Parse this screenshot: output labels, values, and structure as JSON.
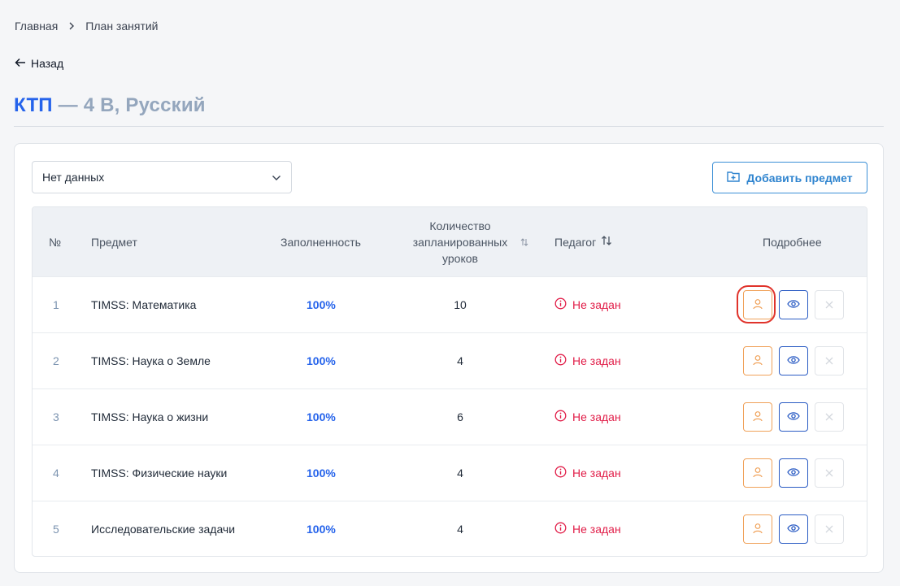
{
  "breadcrumb": {
    "home": "Главная",
    "current": "План занятий"
  },
  "back_label": "Назад",
  "title": {
    "accent": "КТП",
    "rest": " — 4 В, Русский"
  },
  "filter": {
    "value": "Нет данных"
  },
  "add_button_label": "Добавить предмет",
  "table": {
    "headers": {
      "num": "№",
      "subject": "Предмет",
      "fill": "Заполненность",
      "count_line1": "Количество",
      "count_line2": "запланированных",
      "count_line3": "уроков",
      "teacher": "Педагог",
      "details": "Подробнее"
    },
    "rows": [
      {
        "num": "1",
        "subject": "TIMSS: Математика",
        "fill": "100%",
        "count": "10",
        "teacher": "Не задан"
      },
      {
        "num": "2",
        "subject": "TIMSS: Наука о Земле",
        "fill": "100%",
        "count": "4",
        "teacher": "Не задан"
      },
      {
        "num": "3",
        "subject": "TIMSS: Наука о жизни",
        "fill": "100%",
        "count": "6",
        "teacher": "Не задан"
      },
      {
        "num": "4",
        "subject": "TIMSS: Физические науки",
        "fill": "100%",
        "count": "4",
        "teacher": "Не задан"
      },
      {
        "num": "5",
        "subject": "Исследовательские задачи",
        "fill": "100%",
        "count": "4",
        "teacher": "Не задан"
      }
    ]
  },
  "colors": {
    "accent_blue": "#2563eb",
    "warning_red": "#e11d48",
    "assign_orange": "#f0a25a",
    "view_blue": "#2b5cc4",
    "highlight_red": "#e0332b"
  },
  "icons": {
    "breadcrumb_separator": "chevron-right-icon",
    "back": "arrow-left-icon",
    "select": "chevron-down-icon",
    "add": "folder-plus-icon",
    "sort": "sort-icon",
    "teacher_warning": "info-circle-icon",
    "assign": "user-icon",
    "view": "eye-icon",
    "delete": "close-icon"
  }
}
